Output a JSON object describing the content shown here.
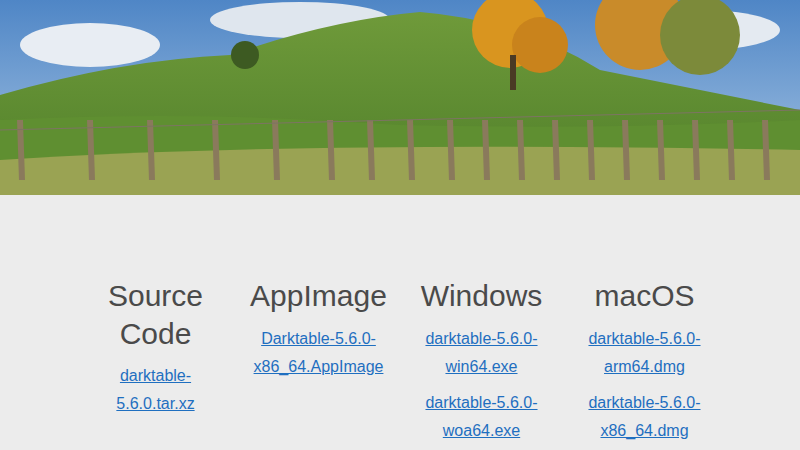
{
  "downloads": [
    {
      "platform": "Source Code",
      "files": [
        "darktable-5.6.0.tar.xz"
      ]
    },
    {
      "platform": "AppImage",
      "files": [
        "Darktable-5.6.0-x86_64.AppImage"
      ]
    },
    {
      "platform": "Windows",
      "files": [
        "darktable-5.6.0-win64.exe",
        "darktable-5.6.0-woa64.exe"
      ]
    },
    {
      "platform": "macOS",
      "files": [
        "darktable-5.6.0-arm64.dmg",
        "darktable-5.6.0-x86_64.dmg"
      ]
    }
  ]
}
